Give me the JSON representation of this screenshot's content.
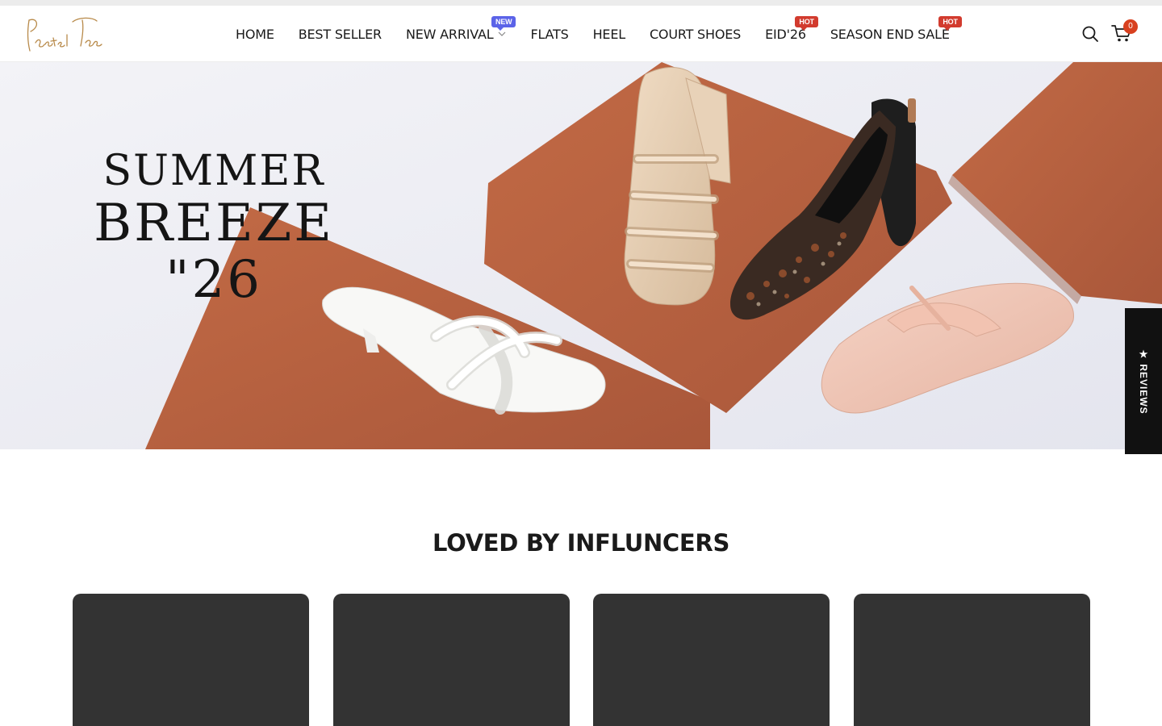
{
  "brand": {
    "logo_text": "Pastel Toes"
  },
  "nav": {
    "items": [
      {
        "label": "HOME"
      },
      {
        "label": "BEST SELLER"
      },
      {
        "label": "NEW ARRIVAL",
        "badge": "NEW"
      },
      {
        "label": "FLATS"
      },
      {
        "label": "HEEL"
      },
      {
        "label": "COURT SHOES"
      },
      {
        "label": "EID'26",
        "badge": "HOT"
      },
      {
        "label": "SEASON END SALE",
        "badge": "HOT"
      }
    ]
  },
  "header_icons": {
    "search": "search-icon",
    "cart": "cart-icon",
    "cart_count": "0"
  },
  "hero": {
    "line1": "SUMMER",
    "line2": "BREEZE \"26"
  },
  "reviews_tab": {
    "label": "★ REVIEWS"
  },
  "influencers": {
    "title": "LOVED BY INFLUNCERS",
    "cards": 4
  },
  "colors": {
    "accent_new": "#5b63e8",
    "accent_hot": "#d23b2e",
    "cart_badge": "#d8401f",
    "terracotta": "#b9613f",
    "card_bg": "#333333"
  }
}
